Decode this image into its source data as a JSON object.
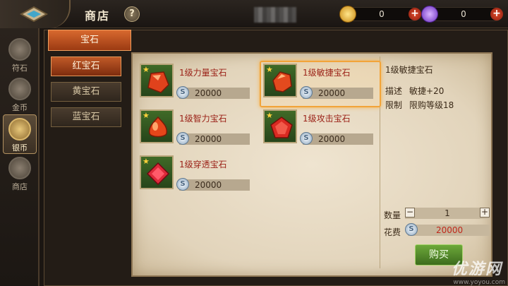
{
  "header": {
    "title": "商店",
    "help_label": "?"
  },
  "currencies": [
    {
      "name": "gold-coin",
      "value": "0",
      "plus": "+",
      "color": "#e8b52a"
    },
    {
      "name": "purple-gem",
      "value": "0",
      "plus": "+",
      "color": "#8a4de0"
    }
  ],
  "sidebar": {
    "items": [
      {
        "label": "符石",
        "active": false
      },
      {
        "label": "金币",
        "active": false
      },
      {
        "label": "银币",
        "active": true
      },
      {
        "label": "商店",
        "active": false
      }
    ]
  },
  "category": {
    "header": "宝石",
    "subs": [
      {
        "label": "红宝石",
        "active": true
      },
      {
        "label": "黄宝石",
        "active": false
      },
      {
        "label": "蓝宝石",
        "active": false
      }
    ]
  },
  "items": [
    {
      "name": "1级力量宝石",
      "price": "20000",
      "selected": false
    },
    {
      "name": "1级敏捷宝石",
      "price": "20000",
      "selected": true
    },
    {
      "name": "1级智力宝石",
      "price": "20000",
      "selected": false
    },
    {
      "name": "1级攻击宝石",
      "price": "20000",
      "selected": false
    },
    {
      "name": "1级穿透宝石",
      "price": "20000",
      "selected": false
    }
  ],
  "detail": {
    "title": "1级敏捷宝石",
    "desc_label": "描述",
    "desc_value": "敏捷+20",
    "limit_label": "限制",
    "limit_value": "限购等级18",
    "qty_label": "数量",
    "qty_minus": "−",
    "qty_value": "1",
    "qty_plus": "+",
    "cost_label": "花费",
    "cost_value": "20000",
    "buy_label": "购买"
  },
  "watermark": {
    "text": "优游网",
    "url": "www.yoyou.com"
  }
}
